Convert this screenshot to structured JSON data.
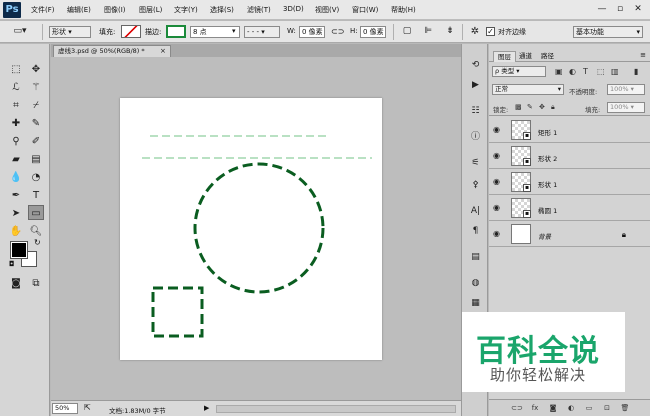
{
  "app": {
    "logo": "Ps",
    "menus": [
      "文件(F)",
      "编辑(E)",
      "图像(I)",
      "图层(L)",
      "文字(Y)",
      "选择(S)",
      "滤镜(T)",
      "3D(D)",
      "视图(V)",
      "窗口(W)",
      "帮助(H)"
    ],
    "window_controls": [
      "—",
      "▫",
      "✕"
    ]
  },
  "options": {
    "shape_mode": "形状",
    "fill_label": "填充:",
    "stroke_label": "描边:",
    "stroke_width": "8 点",
    "w_label": "W:",
    "w_value": "0 像素",
    "h_label": "H:",
    "h_value": "0 像素",
    "align_edges": "对齐边缘",
    "workspace": "基本功能",
    "accent_green": "#0a5d20"
  },
  "document": {
    "tab_title": "虚线3.psd @ 50%(RGB/8) *",
    "close": "×"
  },
  "status": {
    "zoom": "50%",
    "doc_info": "文档:1.83M/0 字节"
  },
  "panel": {
    "tabs": [
      "图层",
      "通道",
      "路径"
    ],
    "filter_kind": "ρ 类型",
    "blend_mode": "正常",
    "opacity_label": "不透明度:",
    "opacity_value": "100%",
    "lock_label": "锁定:",
    "fill_label": "填充:",
    "fill_value": "100%"
  },
  "layers": [
    {
      "name": "矩形 1",
      "type": "shape"
    },
    {
      "name": "形状 2",
      "type": "shape"
    },
    {
      "name": "形状 1",
      "type": "shape"
    },
    {
      "name": "椭圆 1",
      "type": "shape"
    },
    {
      "name": "背景",
      "type": "background"
    }
  ],
  "watermark": {
    "title": "百科全说",
    "subtitle": "助你轻松解决",
    "color": "#1aa56b"
  }
}
